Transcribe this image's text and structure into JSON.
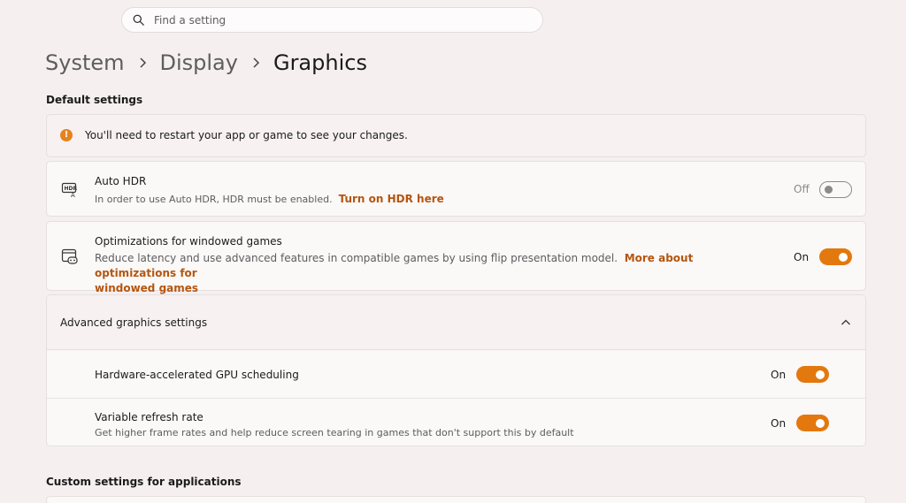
{
  "search": {
    "placeholder": "Find a setting"
  },
  "breadcrumb": {
    "items": [
      "System",
      "Display",
      "Graphics"
    ]
  },
  "default_settings": {
    "title": "Default settings",
    "notice": "You'll need to restart your app or game to see your changes.",
    "auto_hdr": {
      "title": "Auto HDR",
      "description": "In order to use Auto HDR, HDR must be enabled.",
      "link": "Turn on HDR here",
      "state": "Off",
      "enabled": false
    },
    "windowed_games": {
      "title": "Optimizations for windowed games",
      "description": "Reduce latency and use advanced features in compatible games by using flip presentation model.",
      "link_part1": "More about optimizations for",
      "link_part2": "windowed games",
      "state": "On",
      "enabled": true
    }
  },
  "advanced": {
    "title": "Advanced graphics settings",
    "gpu_scheduling": {
      "title": "Hardware-accelerated GPU scheduling",
      "state": "On",
      "enabled": true
    },
    "vrr": {
      "title": "Variable refresh rate",
      "description": "Get higher frame rates and help reduce screen tearing in games that don't support this by default",
      "state": "On",
      "enabled": true
    }
  },
  "custom_settings": {
    "title": "Custom settings for applications"
  },
  "colors": {
    "accent": "#e3780e",
    "link": "#b4560f",
    "background": "#f6eff0"
  },
  "icons": {
    "search": "search-icon",
    "hdr": "hdr-icon",
    "games": "game-window-icon",
    "chevron": "chevron-up-icon",
    "info": "info-icon"
  }
}
